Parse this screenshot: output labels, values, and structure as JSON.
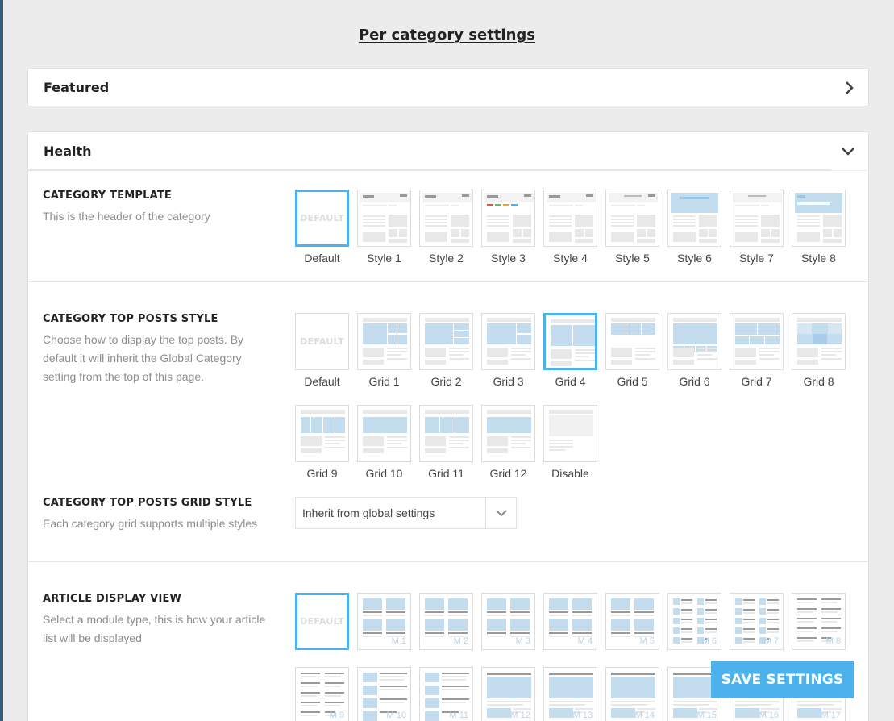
{
  "page_title": "Per category settings",
  "accordion": {
    "featured": "Featured",
    "health": "Health"
  },
  "category_template": {
    "title": "CATEGORY TEMPLATE",
    "description": "This is the header of the category",
    "default_text": "DEFAULT",
    "options": [
      "Default",
      "Style 1",
      "Style 2",
      "Style 3",
      "Style 4",
      "Style 5",
      "Style 6",
      "Style 7",
      "Style 8"
    ],
    "selected": "Default"
  },
  "top_posts_style": {
    "title": "CATEGORY TOP POSTS STYLE",
    "description": "Choose how to display the top posts. By default it will inherit the Global Category setting from the top of this page.",
    "default_text": "DEFAULT",
    "options": [
      "Default",
      "Grid 1",
      "Grid 2",
      "Grid 3",
      "Grid 4",
      "Grid 5",
      "Grid 6",
      "Grid 7",
      "Grid 8",
      "Grid 9",
      "Grid 10",
      "Grid 11",
      "Grid 12",
      "Disable"
    ],
    "selected": "Grid 4"
  },
  "top_posts_grid_style": {
    "title": "CATEGORY TOP POSTS GRID STYLE",
    "description": "Each category grid supports multiple styles",
    "select_value": "Inherit from global settings"
  },
  "article_display": {
    "title": "ARTICLE DISPLAY VIEW",
    "description": "Select a module type, this is how your article list will be displayed",
    "default_text": "DEFAULT",
    "modules": [
      "M 1",
      "M 2",
      "M 3",
      "M 4",
      "M 5",
      "M 6",
      "M 7",
      "M 8",
      "M 9",
      "M 10",
      "M 11",
      "M 12",
      "M 13",
      "M 14",
      "M 15",
      "M 16",
      "M 17"
    ],
    "selected": "Default"
  },
  "save_button": "SAVE SETTINGS",
  "colors": {
    "accent": "#4db2ec",
    "thumb_blue": "#c3dcee",
    "thumb_gray": "#e8e8e8"
  }
}
